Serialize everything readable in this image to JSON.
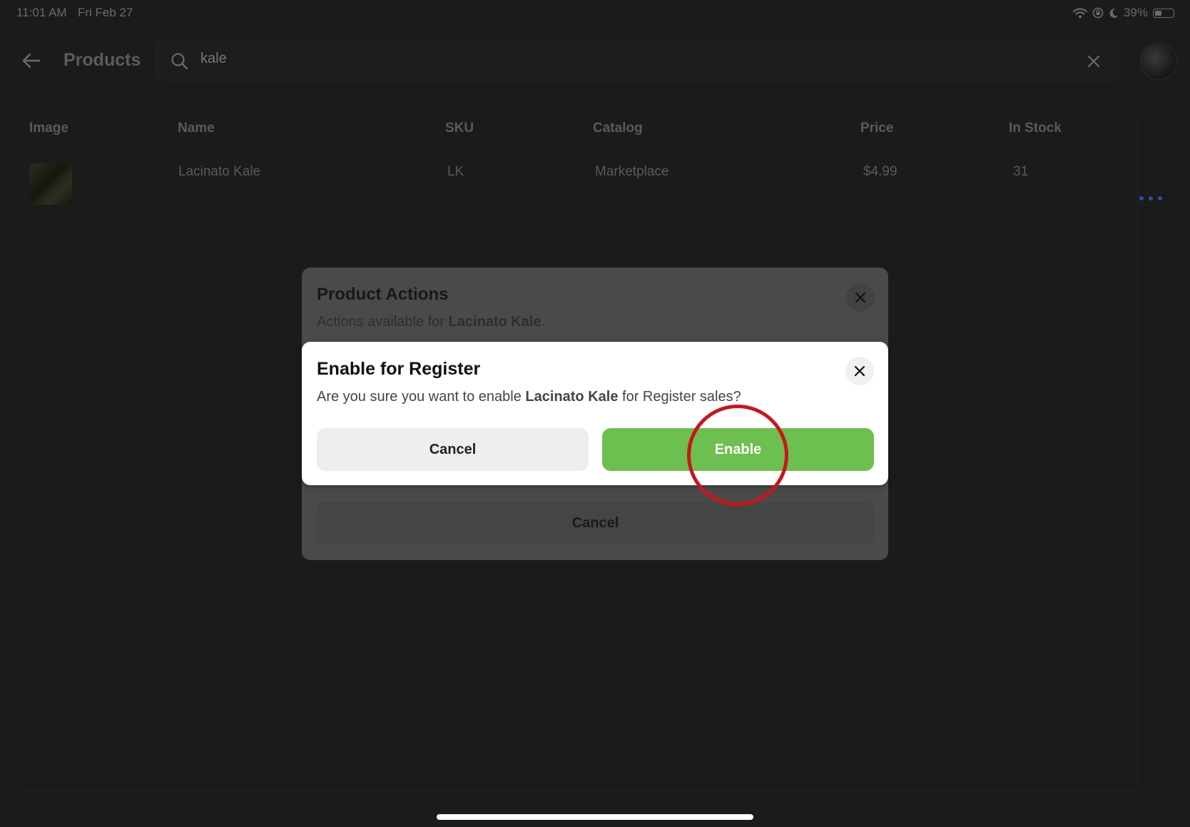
{
  "status_bar": {
    "time": "11:01 AM",
    "date": "Fri Feb 27",
    "battery": "39%",
    "battery_level": 0.39,
    "icons": [
      "wifi-icon",
      "orientation-lock-icon",
      "moon-icon",
      "battery-icon"
    ]
  },
  "header": {
    "title": "Products",
    "search_value": "kale",
    "icons": [
      "back-arrow-icon",
      "search-icon",
      "clear-icon",
      "avatar"
    ]
  },
  "table": {
    "columns": [
      "Image",
      "Name",
      "SKU",
      "Catalog",
      "Price",
      "In Stock"
    ],
    "rows": [
      {
        "name": "Lacinato Kale",
        "sku": "LK",
        "catalog": "Marketplace",
        "price": "$4.99",
        "in_stock": "31"
      }
    ]
  },
  "product_actions": {
    "title": "Product Actions",
    "subtitle_prefix": "Actions available for ",
    "product": "Lacinato Kale",
    "subtitle_suffix": ".",
    "cancel_label": "Cancel"
  },
  "dialog": {
    "title": "Enable for Register",
    "body_prefix": "Are you sure you want to enable ",
    "product": "Lacinato Kale",
    "body_suffix": " for Register sales?",
    "cancel_label": "Cancel",
    "enable_label": "Enable"
  },
  "colors": {
    "background": "#1b1b1b",
    "enable_button": "#6dbf4f",
    "annotation": "#c8161c",
    "more_dots": "#2a4fa3"
  }
}
